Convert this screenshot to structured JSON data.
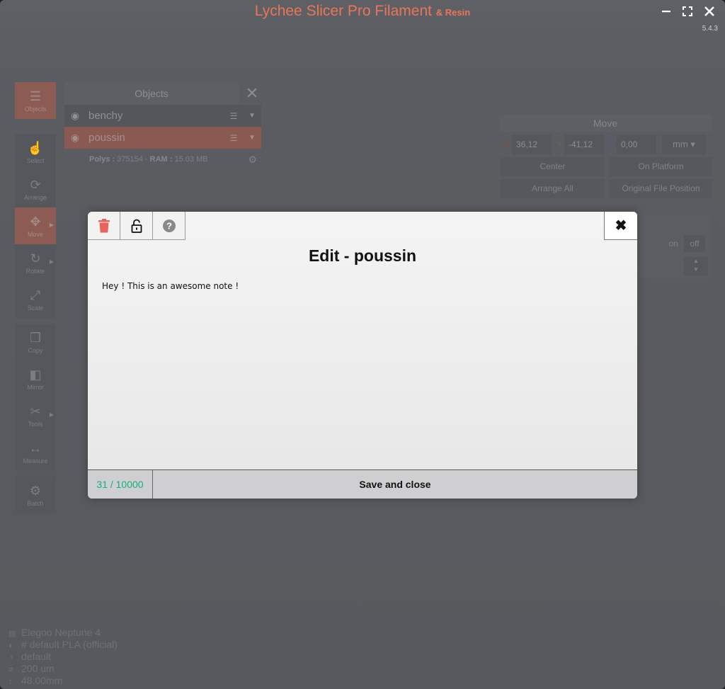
{
  "app": {
    "title": "Lychee Slicer Pro Filament",
    "title_suffix": "& Resin",
    "version": "5.4.3",
    "accent_color": "#e8765a"
  },
  "window_controls": {
    "minimize": "minimize-icon",
    "maximize": "maximize-icon",
    "close": "close-icon"
  },
  "toolbar": {
    "items": [
      {
        "label": "Objects",
        "icon": "list-icon"
      },
      {
        "label": "Select",
        "icon": "pointer-icon"
      },
      {
        "label": "Arrange",
        "icon": "arrange-icon"
      },
      {
        "label": "Move",
        "icon": "move-icon"
      },
      {
        "label": "Rotate",
        "icon": "rotate-icon"
      },
      {
        "label": "Scale",
        "icon": "scale-icon"
      },
      {
        "label": "Copy",
        "icon": "copy-icon"
      },
      {
        "label": "Mirror",
        "icon": "mirror-icon"
      },
      {
        "label": "Tools",
        "icon": "scissors-icon"
      },
      {
        "label": "Measure",
        "icon": "measure-icon"
      },
      {
        "label": "Batch",
        "icon": "batch-icon"
      }
    ]
  },
  "objects_panel": {
    "title": "Objects",
    "items": [
      {
        "name": "benchy"
      },
      {
        "name": "poussin"
      }
    ],
    "polys_label": "Polys :",
    "polys_value": "375154",
    "ram_label": "RAM :",
    "ram_value": "15.03 MB"
  },
  "move_panel": {
    "title": "Move",
    "x_label": "X",
    "x": "36,12",
    "y_label": "Y",
    "y": "-41,12",
    "z_label": "Z",
    "z": "0,00",
    "unit": "mm",
    "center": "Center",
    "on_platform": "On Platform",
    "arrange_all": "Arrange All",
    "original_position": "Original File Position",
    "on": "on",
    "off": "off"
  },
  "printer_info": {
    "printer": "Elegoo Neptune 4",
    "material": "# default PLA (official)",
    "profile": "default",
    "layer": "200 um",
    "height": "48.00mm"
  },
  "modal": {
    "title": "Edit - poussin",
    "note": "Hey ! This is an awesome note !",
    "counter": "31 / 10000",
    "save_label": "Save and close",
    "delete_color": "#e8645a",
    "counter_color": "#13b07a"
  }
}
